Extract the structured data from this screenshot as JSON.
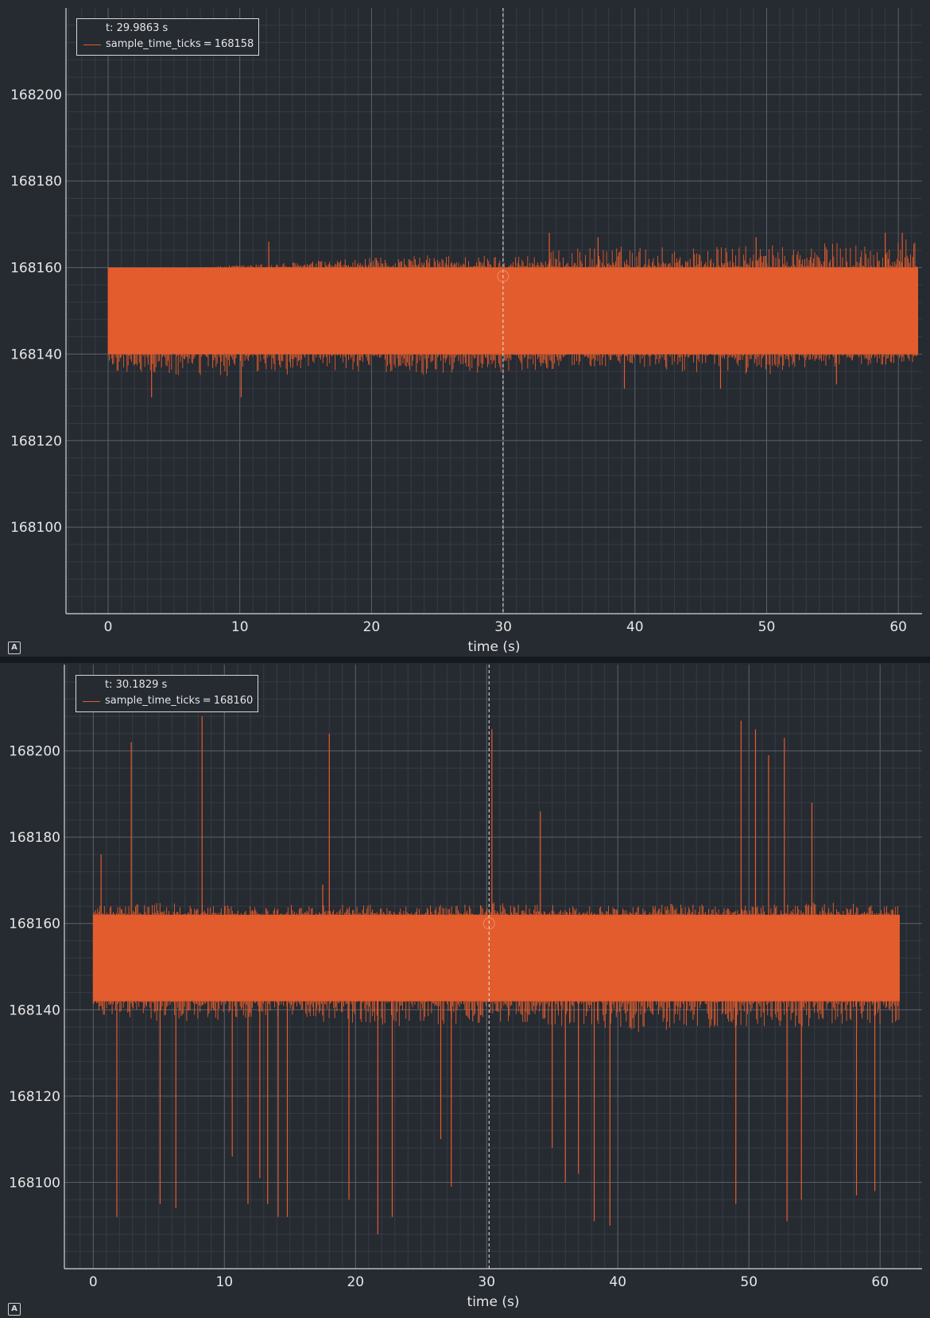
{
  "plots": [
    {
      "legend": {
        "cursor_label": "t: 29.9863 s",
        "series_label": "sample_time_ticks",
        "series_value": "168158"
      },
      "autoscale_icon": "A"
    },
    {
      "legend": {
        "cursor_label": "t: 30.1829 s",
        "series_label": "sample_time_ticks",
        "series_value": "168160"
      },
      "autoscale_icon": "A"
    }
  ],
  "colors": {
    "series": "#e35d2e",
    "background": "#262a31",
    "grid_major": "#5d626b",
    "grid_minor": "#373b43",
    "text": "#e6e6e6"
  },
  "chart_data": [
    {
      "type": "line",
      "xlabel": "time (s)",
      "ylabel": "",
      "xlim": [
        -3.2,
        61.8
      ],
      "ylim": [
        168080,
        168220
      ],
      "x_ticks": [
        0,
        10,
        20,
        30,
        40,
        50,
        60
      ],
      "y_ticks": [
        168100,
        168120,
        168140,
        168160,
        168180,
        168200
      ],
      "cursor_x": 29.9863,
      "cursor_y": 168158,
      "grid": true,
      "legend": "top-left",
      "series": [
        {
          "name": "sample_time_ticks",
          "x_range": [
            0,
            61.5
          ],
          "typical_band": [
            168140,
            168160
          ],
          "envelope_min": [
            168136,
            168134,
            168135,
            168136,
            168135,
            168136,
            168137,
            168136,
            168135,
            168137,
            168138
          ],
          "envelope_max": [
            168158,
            168160,
            168161,
            168162,
            168163,
            168163,
            168165,
            168165,
            168165,
            168166,
            168167
          ],
          "spikes": [
            {
              "t": 3.3,
              "v": 168130
            },
            {
              "t": 10.1,
              "v": 168130
            },
            {
              "t": 12.2,
              "v": 168166
            },
            {
              "t": 33.5,
              "v": 168168
            },
            {
              "t": 37.2,
              "v": 168167
            },
            {
              "t": 39.2,
              "v": 168132
            },
            {
              "t": 46.5,
              "v": 168132
            },
            {
              "t": 49.2,
              "v": 168167
            },
            {
              "t": 55.3,
              "v": 168133
            },
            {
              "t": 59.0,
              "v": 168168
            },
            {
              "t": 60.3,
              "v": 168168
            }
          ]
        }
      ]
    },
    {
      "type": "line",
      "xlabel": "time (s)",
      "ylabel": "",
      "xlim": [
        -2.2,
        63.2
      ],
      "ylim": [
        168080,
        168220
      ],
      "x_ticks": [
        0,
        10,
        20,
        30,
        40,
        50,
        60
      ],
      "y_ticks": [
        168100,
        168120,
        168140,
        168160,
        168180,
        168200
      ],
      "cursor_x": 30.1829,
      "cursor_y": 168160,
      "grid": true,
      "legend": "top-left",
      "series": [
        {
          "name": "sample_time_ticks",
          "x_range": [
            0,
            61.5
          ],
          "typical_band": [
            168142,
            168162
          ],
          "envelope_min": [
            168139,
            168137,
            168138,
            168137,
            168136,
            168137,
            168136,
            168134,
            168136,
            168136,
            168137
          ],
          "envelope_max": [
            168164,
            168165,
            168164,
            168165,
            168164,
            168165,
            168164,
            168165,
            168164,
            168165,
            168164
          ],
          "spikes": [
            {
              "t": 0.6,
              "v": 168176
            },
            {
              "t": 1.8,
              "v": 168092
            },
            {
              "t": 2.9,
              "v": 168202
            },
            {
              "t": 5.1,
              "v": 168095
            },
            {
              "t": 6.3,
              "v": 168094
            },
            {
              "t": 8.3,
              "v": 168208
            },
            {
              "t": 10.6,
              "v": 168106
            },
            {
              "t": 11.8,
              "v": 168095
            },
            {
              "t": 12.7,
              "v": 168101
            },
            {
              "t": 13.3,
              "v": 168095
            },
            {
              "t": 14.1,
              "v": 168092
            },
            {
              "t": 14.8,
              "v": 168092
            },
            {
              "t": 17.5,
              "v": 168169
            },
            {
              "t": 18.0,
              "v": 168204
            },
            {
              "t": 19.5,
              "v": 168096
            },
            {
              "t": 21.7,
              "v": 168088
            },
            {
              "t": 22.8,
              "v": 168092
            },
            {
              "t": 26.5,
              "v": 168110
            },
            {
              "t": 27.3,
              "v": 168099
            },
            {
              "t": 30.4,
              "v": 168205
            },
            {
              "t": 34.1,
              "v": 168186
            },
            {
              "t": 35.0,
              "v": 168108
            },
            {
              "t": 36.0,
              "v": 168100
            },
            {
              "t": 37.0,
              "v": 168102
            },
            {
              "t": 38.2,
              "v": 168091
            },
            {
              "t": 39.4,
              "v": 168090
            },
            {
              "t": 49.4,
              "v": 168207
            },
            {
              "t": 50.5,
              "v": 168205
            },
            {
              "t": 51.5,
              "v": 168199
            },
            {
              "t": 52.7,
              "v": 168203
            },
            {
              "t": 52.9,
              "v": 168091
            },
            {
              "t": 54.0,
              "v": 168096
            },
            {
              "t": 54.8,
              "v": 168188
            },
            {
              "t": 58.2,
              "v": 168097
            },
            {
              "t": 59.6,
              "v": 168098
            },
            {
              "t": 49.0,
              "v": 168095
            }
          ]
        }
      ]
    }
  ]
}
